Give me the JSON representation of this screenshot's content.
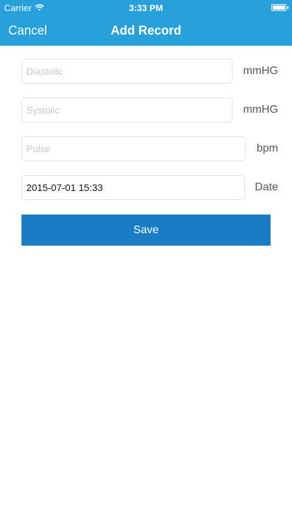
{
  "status_bar": {
    "carrier": "Carrier",
    "time": "3:33 PM",
    "wifi_icon": "wifi-icon",
    "battery_level": 1.0
  },
  "navbar": {
    "cancel_label": "Cancel",
    "title": "Add Record"
  },
  "form": {
    "diastolic": {
      "value": "",
      "placeholder": "Diastolic",
      "unit": "mmHG"
    },
    "systolic": {
      "value": "",
      "placeholder": "Systolic",
      "unit": "mmHG"
    },
    "pulse": {
      "value": "",
      "placeholder": "Pulse",
      "unit": "bpm"
    },
    "date": {
      "value": "2015-07-01 15:33",
      "placeholder": "",
      "unit": "Date"
    },
    "save_label": "Save"
  },
  "colors": {
    "navbar_bg": "#27a0dc",
    "save_bg": "#1a7cc4"
  }
}
